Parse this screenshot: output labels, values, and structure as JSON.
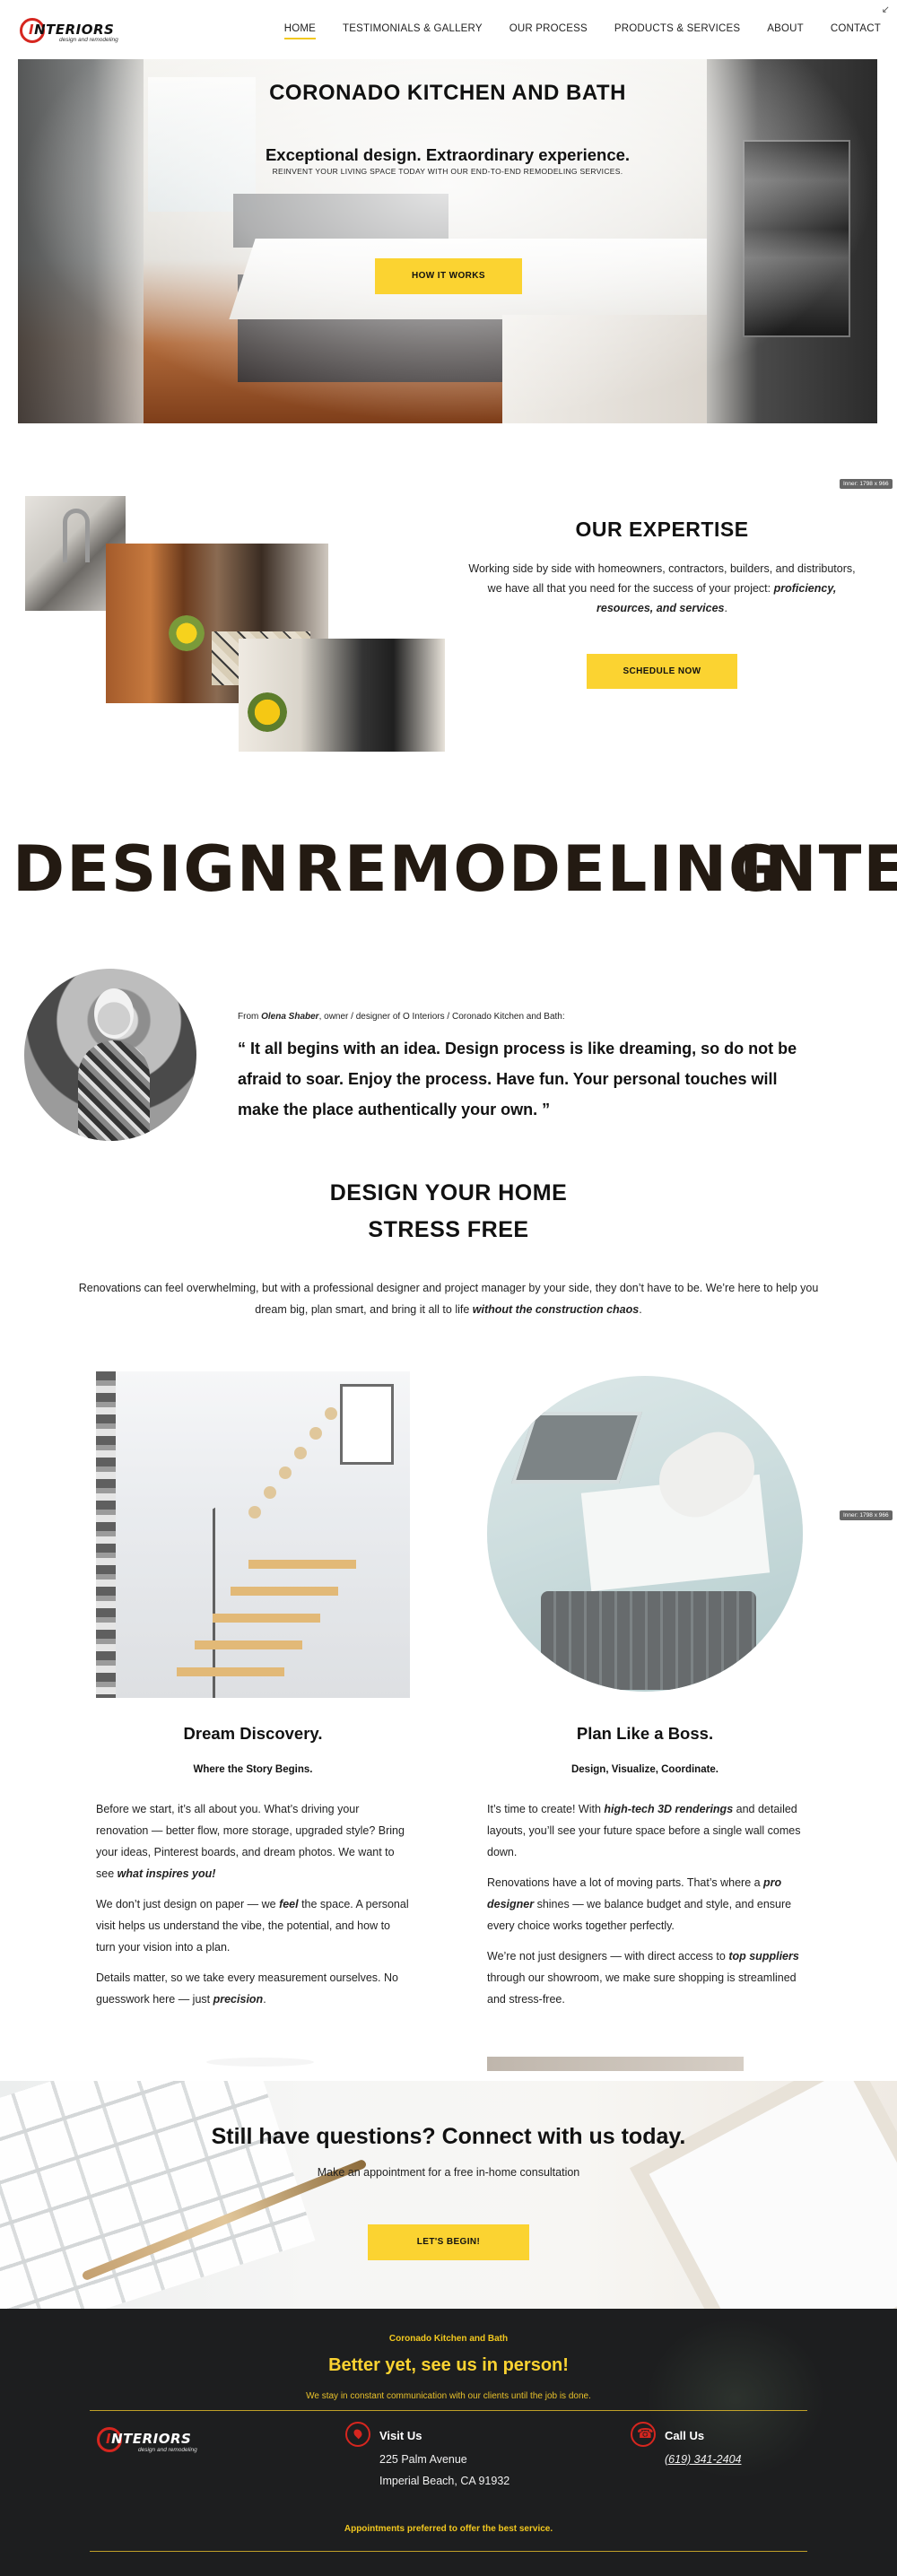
{
  "header": {
    "logo_text_1": "I",
    "logo_text_2": "NTERIORS",
    "logo_tagline": "design and remodeling",
    "nav": [
      "HOME",
      "TESTIMONIALS & GALLERY",
      "OUR PROCESS",
      "PRODUCTS & SERVICES",
      "ABOUT",
      "CONTACT"
    ],
    "active_nav": "HOME",
    "corner_icon": "collapse-icon"
  },
  "hero": {
    "title": "CORONADO KITCHEN AND BATH",
    "subtitle": "Exceptional design. Extraordinary experience.",
    "small": "REINVENT YOUR LIVING SPACE TODAY WITH OUR  END-TO-END  REMODELING SERVICES.",
    "button": "HOW IT WORKS"
  },
  "badges": {
    "inner_1": "Inner: 1798 x 966",
    "inner_2": "Inner: 1798 x 966"
  },
  "expertise": {
    "title": "OUR EXPERTISE",
    "text": "Working side by side with homeowners, contractors, builders, and distributors, we have all that you need for the success of your project: ",
    "text_emph": "proficiency, resources, and services",
    "text_end": ".",
    "button": "SCHEDULE NOW"
  },
  "marquee": [
    "DESIGN",
    "REMODELING",
    "INTER"
  ],
  "quote": {
    "from_prefix": "From ",
    "from_name": "Olena Shaber",
    "from_suffix": ", owner / designer of O Interiors / Coronado Kitchen and Bath:",
    "text": "“ It all begins with an idea. Design process is like dreaming, so do not be afraid to soar.  Enjoy the process.  Have fun.  Your personal touches will make the place authentically your own. ”"
  },
  "stress": {
    "title_line1": "DESIGN YOUR HOME",
    "title_line2": "STRESS FREE",
    "text": "Renovations can feel overwhelming, but with a professional designer and project manager by your side, they don’t have to be. We’re here to help you dream big, plan smart, and bring it all to life ",
    "text_emph": "without the construction chaos",
    "text_end": "."
  },
  "col_left": {
    "heading": "Dream Discovery.",
    "sub": "Where the Story Begins.",
    "p1": "Before we start, it’s all about you. What’s driving your renovation — better flow, more storage, upgraded style? Bring your ideas, Pinterest boards, and dream photos. We want to see ",
    "p1_emph": "what inspires you!",
    "p2_a": "We don’t just design on paper — we ",
    "p2_emph": "feel",
    "p2_b": " the space. A personal visit helps us understand the vibe, the potential, and how to turn your vision into a plan.",
    "p3_a": "Details matter, so we take every measurement ourselves. No guesswork here — just ",
    "p3_emph": "precision",
    "p3_b": "."
  },
  "col_right": {
    "heading": "Plan Like a Boss.",
    "sub": "Design, Visualize, Coordinate.",
    "p1_a": "It’s time to create! With ",
    "p1_emph": "high-tech 3D renderings",
    "p1_b": " and detailed layouts, you’ll see your future space before a single wall comes down.",
    "p2_a": "Renovations have a lot of moving parts. That’s where a ",
    "p2_emph": "pro designer",
    "p2_b": " shines — we balance budget and style, and ensure every choice works together perfectly.",
    "p3_a": "We’re not just designers — with direct access to ",
    "p3_emph": "top suppliers",
    "p3_b": " through our showroom, we make sure shopping is streamlined and stress-free."
  },
  "questions": {
    "title": "Still have questions?   Connect with us today.",
    "sub": "Make an appointment for a free in-home consultation",
    "button": "LET'S BEGIN!"
  },
  "footer": {
    "small_title": "Coronado Kitchen and Bath",
    "big_title": "Better yet, see us in person!",
    "note": "We stay in constant communication with our clients until the job is done.",
    "visit_heading": "Visit Us",
    "address_1": "225 Palm Avenue",
    "address_2": "Imperial Beach, CA 91932",
    "call_heading": "Call Us",
    "phone": "(619) 341-2404",
    "appointments": "Appointments preferred to offer the best service."
  },
  "colors": {
    "accent_yellow": "#fbd331",
    "brand_red": "#d6261f",
    "footer_bg": "#1d1e1f"
  }
}
